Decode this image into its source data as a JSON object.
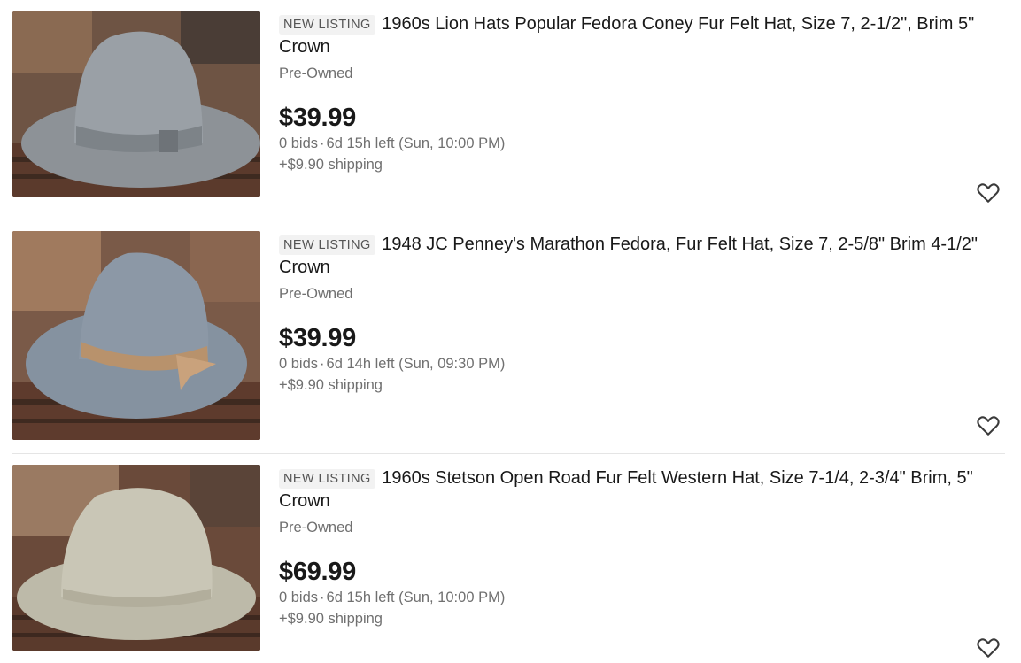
{
  "listings": [
    {
      "badge": "NEW LISTING",
      "title": "1960s Lion Hats Popular Fedora Coney Fur Felt Hat, Size 7, 2-1/2\", Brim 5\" Crown",
      "condition": "Pre-Owned",
      "price": "$39.99",
      "bids": "0 bids",
      "time_left": "6d 15h left (Sun, 10:00 PM)",
      "shipping": "+$9.90 shipping",
      "image_icon": "gray-fedora-photo",
      "hat_color": "#9aa0a6"
    },
    {
      "badge": "NEW LISTING",
      "title": "1948 JC Penney's Marathon Fedora, Fur Felt Hat, Size 7, 2-5/8\" Brim 4-1/2\" Crown",
      "condition": "Pre-Owned",
      "price": "$39.99",
      "bids": "0 bids",
      "time_left": "6d 14h left (Sun, 09:30 PM)",
      "shipping": "+$9.90 shipping",
      "image_icon": "blue-gray-fedora-photo",
      "hat_color": "#8c98a6"
    },
    {
      "badge": "NEW LISTING",
      "title": "1960s Stetson Open Road Fur Felt Western Hat, Size 7-1/4, 2-3/4\" Brim, 5\" Crown",
      "condition": "Pre-Owned",
      "price": "$69.99",
      "bids": "0 bids",
      "time_left": "6d 15h left (Sun, 10:00 PM)",
      "shipping": "+$9.90 shipping",
      "image_icon": "silverbelly-western-hat-photo",
      "hat_color": "#c9c6b6"
    }
  ],
  "watch_icon": "heart-icon",
  "colors": {
    "text": "#191919",
    "muted": "#707070",
    "badge_bg": "#f2f2f2",
    "divider": "#e5e5e5"
  }
}
